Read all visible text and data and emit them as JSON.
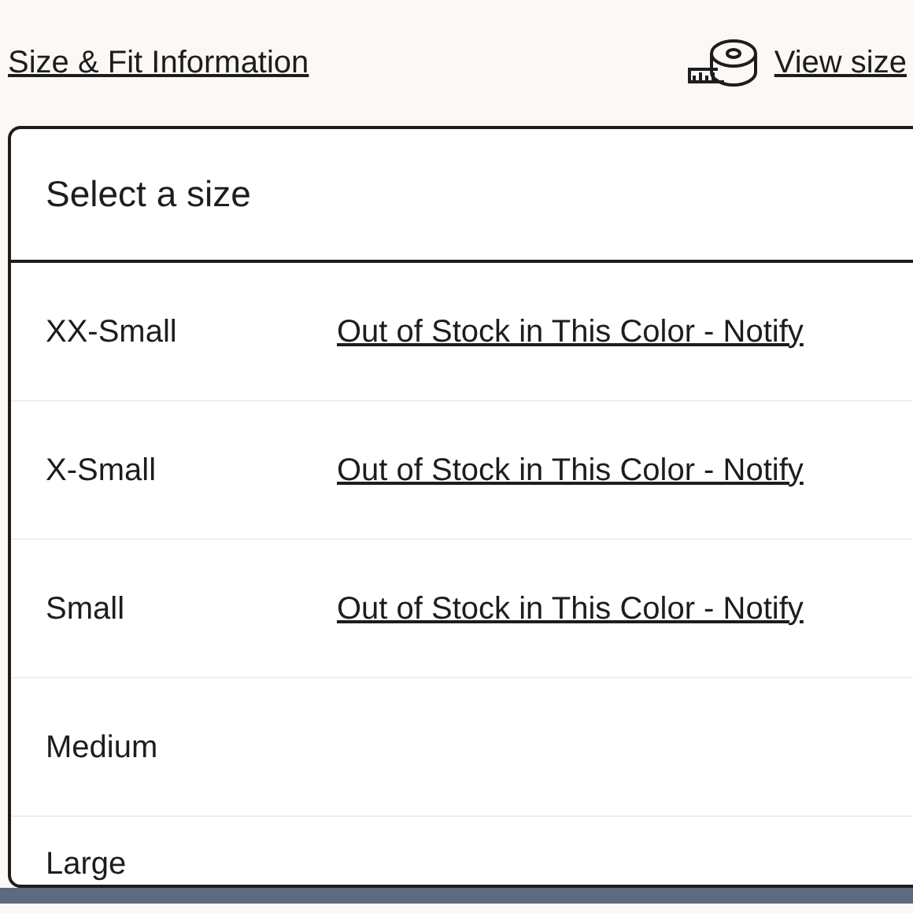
{
  "links": {
    "size_fit": "Size & Fit Information",
    "size_chart": "View size"
  },
  "dropdown": {
    "title": "Select a size",
    "options": [
      {
        "label": "XX-Small",
        "note": "Out of Stock in This Color - Notify"
      },
      {
        "label": "X-Small",
        "note": "Out of Stock in This Color - Notify"
      },
      {
        "label": "Small",
        "note": "Out of Stock in This Color - Notify"
      },
      {
        "label": "Medium"
      },
      {
        "label": "Large"
      }
    ]
  }
}
